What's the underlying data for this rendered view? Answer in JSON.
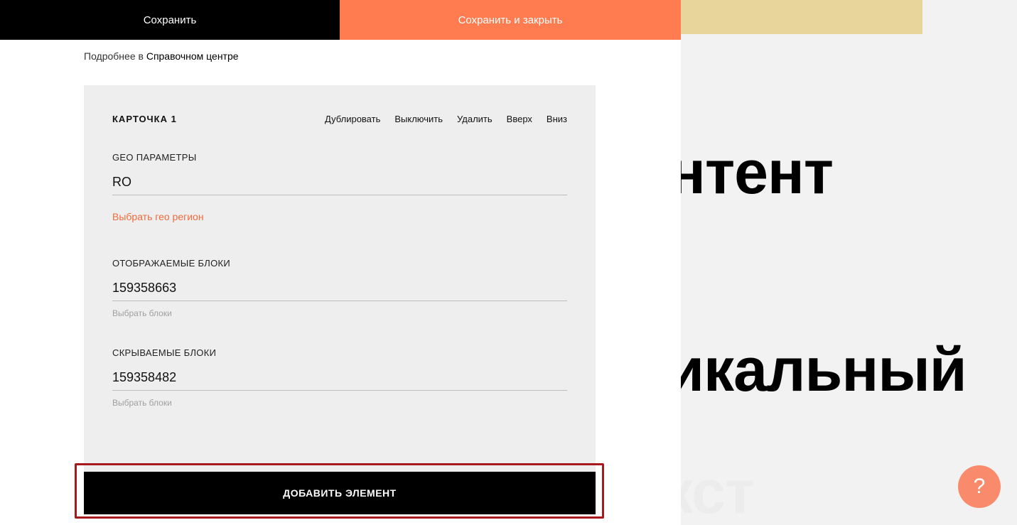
{
  "toolbar": {
    "save_label": "Сохранить",
    "save_close_label": "Сохранить и закрыть"
  },
  "help": {
    "prefix": "Подробнее в",
    "link": "Справочном центре"
  },
  "card": {
    "title": "КАРТОЧКА 1",
    "actions": [
      "Дублировать",
      "Выключить",
      "Удалить",
      "Вверх",
      "Вниз"
    ],
    "geo": {
      "label": "GEO ПАРАМЕТРЫ",
      "value": "RO",
      "link": "Выбрать гео регион"
    },
    "shown_blocks": {
      "label": "ОТОБРАЖАЕМЫЕ БЛОКИ",
      "value": "159358663",
      "hint": "Выбрать блоки"
    },
    "hidden_blocks": {
      "label": "СКРЫВАЕМЫЕ БЛОКИ",
      "value": "159358482",
      "hint": "Выбрать блоки"
    }
  },
  "add_button_label": "ДОБАВИТЬ ЭЛЕМЕНТ",
  "background": {
    "word1": "Контент",
    "word2": "Уникальный",
    "word3": "Текст"
  },
  "help_bubble_glyph": "?",
  "colors": {
    "orange": "#fe7c50",
    "link_orange": "#f06a3c",
    "yellow": "#e8d59c",
    "highlight_red": "#a8191d"
  }
}
